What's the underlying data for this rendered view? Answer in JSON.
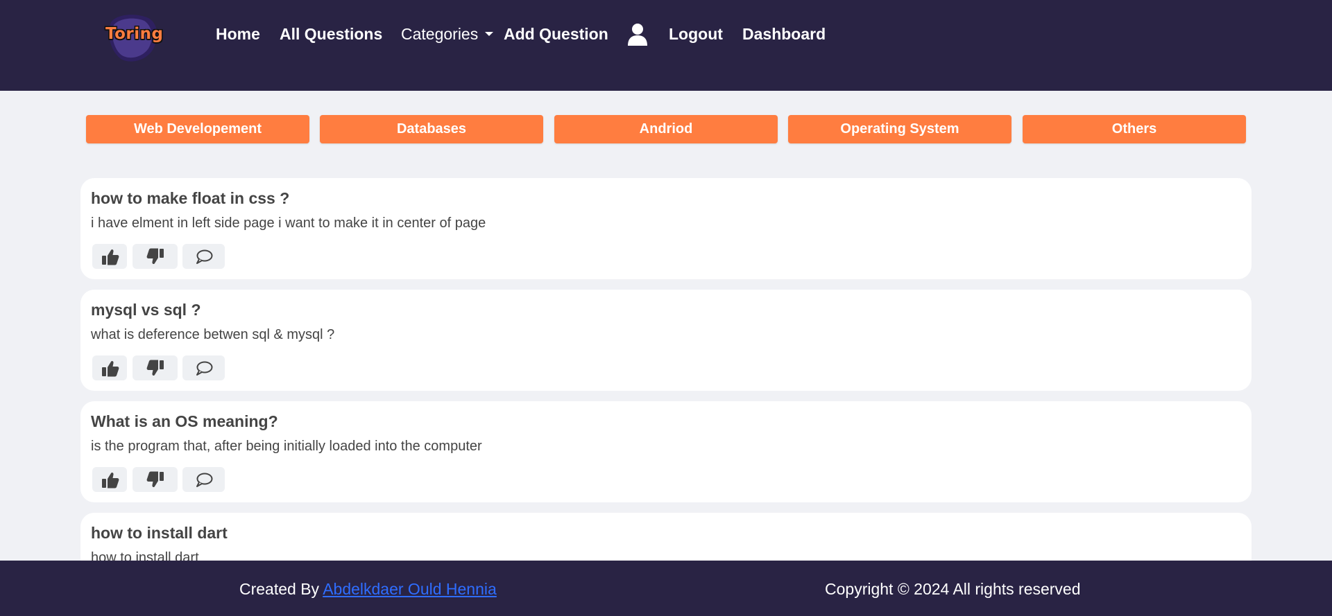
{
  "header": {
    "logo_text": "Toring",
    "nav": {
      "home": "Home",
      "all_questions": "All Questions",
      "categories": "Categories",
      "add_question": "Add Question",
      "logout": "Logout",
      "dashboard": "Dashboard"
    }
  },
  "categories": [
    {
      "label": "Web Developement"
    },
    {
      "label": "Databases"
    },
    {
      "label": "Andriod"
    },
    {
      "label": "Operating System"
    },
    {
      "label": "Others"
    }
  ],
  "questions": [
    {
      "title": "how to make float in css ?",
      "body": "i have elment in left side page i want to make it in center of page"
    },
    {
      "title": "mysql vs sql ?",
      "body": "what is deference betwen sql & mysql ?"
    },
    {
      "title": "What is an OS meaning?",
      "body": "is the program that, after being initially loaded into the computer"
    },
    {
      "title": "how to install dart",
      "body": "how to install dart"
    }
  ],
  "icons": {
    "like": "thumbs-up-icon",
    "dislike": "thumbs-down-icon",
    "comment": "comment-icon",
    "user": "user-icon"
  },
  "colors": {
    "header_bg": "#292344",
    "accent": "#ff7d40",
    "page_bg": "#f0f1f5",
    "link": "#2f6dff"
  },
  "footer": {
    "created_by_prefix": "Created By",
    "author": "Abdelkdaer Ould Hennia",
    "copyright": "Copyright © 2024 All rights reserved"
  }
}
